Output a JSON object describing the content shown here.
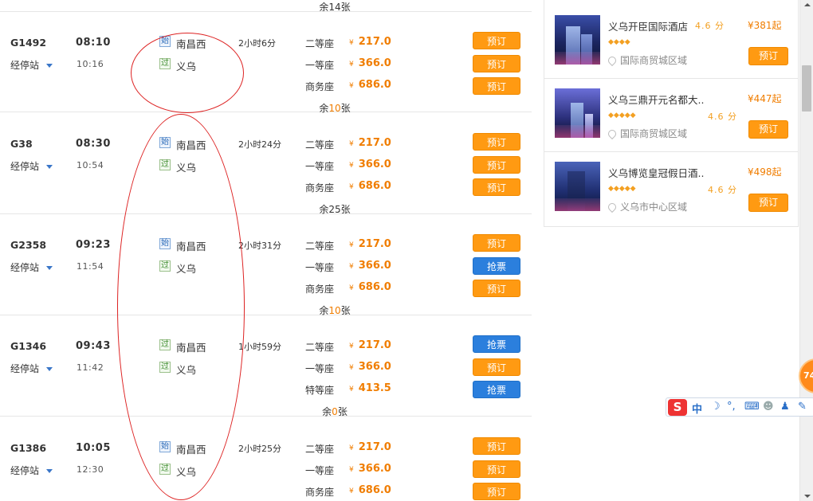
{
  "trains": [
    {
      "number": "G1492",
      "stops_label": "经停站",
      "dep": "08:10",
      "arr": "10:16",
      "from_badge": "始",
      "from": "南昌西",
      "to_badge": "过",
      "to": "义乌",
      "duration": "2小时6分",
      "seats": [
        {
          "name": "二等座",
          "currency": "¥",
          "price": "217.0",
          "button": "预订",
          "type": "book"
        },
        {
          "name": "一等座",
          "currency": "¥",
          "price": "366.0",
          "button": "预订",
          "type": "book"
        },
        {
          "name": "商务座",
          "currency": "¥",
          "price": "686.0",
          "button": "预订",
          "type": "book"
        }
      ],
      "remain_prefix": "余",
      "remain_num": "10",
      "remain_suffix": "张"
    },
    {
      "number": "G38",
      "stops_label": "经停站",
      "dep": "08:30",
      "arr": "10:54",
      "from_badge": "始",
      "from": "南昌西",
      "to_badge": "过",
      "to": "义乌",
      "duration": "2小时24分",
      "seats": [
        {
          "name": "二等座",
          "currency": "¥",
          "price": "217.0",
          "button": "预订",
          "type": "book"
        },
        {
          "name": "一等座",
          "currency": "¥",
          "price": "366.0",
          "button": "预订",
          "type": "book"
        },
        {
          "name": "商务座",
          "currency": "¥",
          "price": "686.0",
          "button": "预订",
          "type": "book"
        }
      ],
      "remain_prefix": "余",
      "remain_num": "25",
      "remain_suffix": "张"
    },
    {
      "number": "G2358",
      "stops_label": "经停站",
      "dep": "09:23",
      "arr": "11:54",
      "from_badge": "始",
      "from": "南昌西",
      "to_badge": "过",
      "to": "义乌",
      "duration": "2小时31分",
      "seats": [
        {
          "name": "二等座",
          "currency": "¥",
          "price": "217.0",
          "button": "预订",
          "type": "book"
        },
        {
          "name": "一等座",
          "currency": "¥",
          "price": "366.0",
          "button": "抢票",
          "type": "grab"
        },
        {
          "name": "商务座",
          "currency": "¥",
          "price": "686.0",
          "button": "预订",
          "type": "book"
        }
      ],
      "remain_prefix": "余",
      "remain_num": "10",
      "remain_suffix": "张"
    },
    {
      "number": "G1346",
      "stops_label": "经停站",
      "dep": "09:43",
      "arr": "11:42",
      "from_badge": "过",
      "from": "南昌西",
      "to_badge": "过",
      "to": "义乌",
      "duration": "1小时59分",
      "seats": [
        {
          "name": "二等座",
          "currency": "¥",
          "price": "217.0",
          "button": "抢票",
          "type": "grab"
        },
        {
          "name": "一等座",
          "currency": "¥",
          "price": "366.0",
          "button": "预订",
          "type": "book"
        },
        {
          "name": "特等座",
          "currency": "¥",
          "price": "413.5",
          "button": "抢票",
          "type": "grab"
        }
      ],
      "remain_prefix": "余",
      "remain_num": "0",
      "remain_suffix": "张"
    },
    {
      "number": "G1386",
      "stops_label": "经停站",
      "dep": "10:05",
      "arr": "12:30",
      "from_badge": "始",
      "from": "南昌西",
      "to_badge": "过",
      "to": "义乌",
      "duration": "2小时25分",
      "seats": [
        {
          "name": "二等座",
          "currency": "¥",
          "price": "217.0",
          "button": "预订",
          "type": "book"
        },
        {
          "name": "一等座",
          "currency": "¥",
          "price": "366.0",
          "button": "预订",
          "type": "book"
        },
        {
          "name": "商务座",
          "currency": "¥",
          "price": "686.0",
          "button": "预订",
          "type": "book"
        }
      ],
      "remain_prefix": "",
      "remain_num": "",
      "remain_suffix": ""
    }
  ],
  "top_remain": "余14张",
  "hotels": [
    {
      "name": "义乌开臣国际酒店",
      "score": "4.6 分",
      "price": "¥381起",
      "stars": "◆◆◆◆",
      "location": "国际商贸城区域",
      "button": "预订"
    },
    {
      "name": "义乌三鼎开元名都大..",
      "score": "4.6 分",
      "price": "¥447起",
      "stars": "◆◆◆◆◆",
      "location": "国际商贸城区域",
      "button": "预订"
    },
    {
      "name": "义乌博览皇冠假日酒..",
      "score": "4.6 分",
      "price": "¥498起",
      "stars": "◆◆◆◆◆",
      "location": "义乌市中心区域",
      "button": "预订"
    }
  ],
  "float_badge": "74",
  "ime": {
    "logo": "S",
    "mode": "中",
    "moon": "☽",
    "punct": "°,",
    "keyboard": "⌨",
    "user": "☻",
    "shirt": "♟",
    "tool": "✎"
  },
  "colors": {
    "book": "#ff9a12",
    "grab": "#2b7fdd",
    "price": "#f07d00",
    "annotation": "#dd2222"
  }
}
